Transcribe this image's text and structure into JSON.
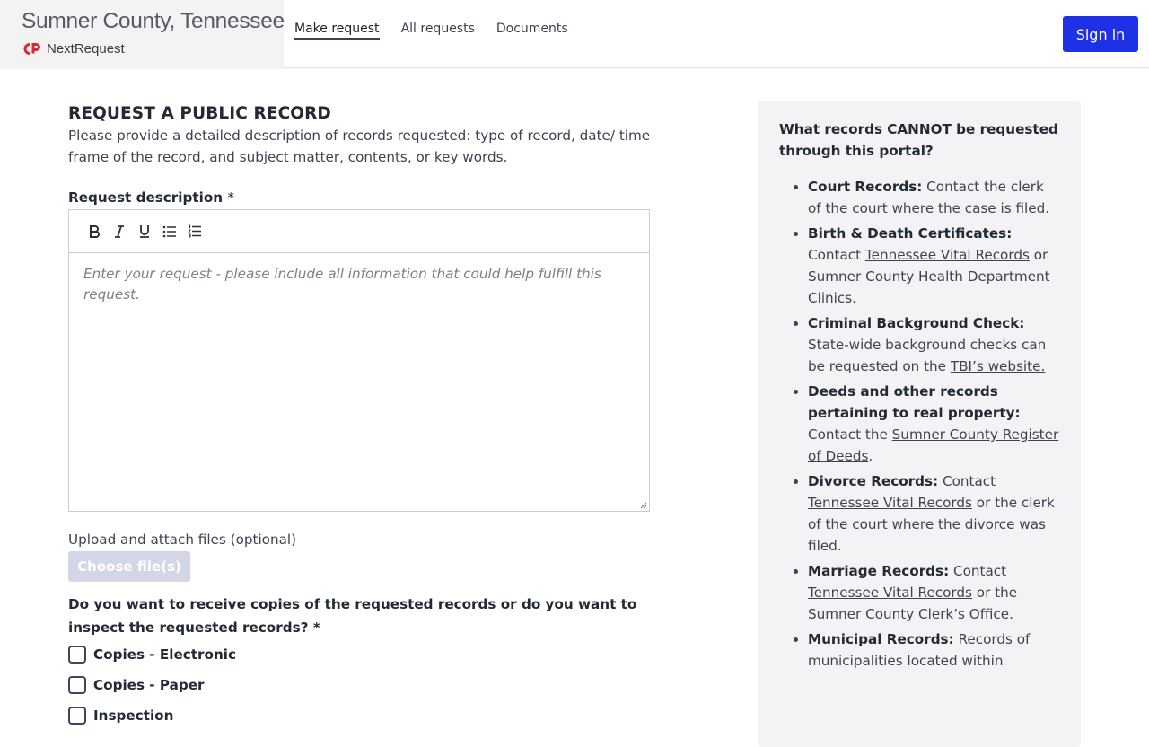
{
  "header": {
    "site_title": "Sumner County, Tennessee",
    "brand_name": "NextRequest",
    "nav": [
      {
        "label": "Make request",
        "active": true
      },
      {
        "label": "All requests",
        "active": false
      },
      {
        "label": "Documents",
        "active": false
      }
    ],
    "sign_in_label": "Sign in"
  },
  "form": {
    "title": "REQUEST A PUBLIC RECORD",
    "intro": "Please provide a detailed description of records requested: type of record, date/ time frame of the record, and subject matter, contents, or key words.",
    "description_label": "Request description",
    "required_mark": "*",
    "editor_toolbar": [
      "bold-icon",
      "italic-icon",
      "underline-icon",
      "bulleted-list-icon",
      "numbered-list-icon"
    ],
    "editor_placeholder": "Enter your request - please include all information that could help fulfill this request.",
    "upload_label": "Upload and attach files (optional)",
    "choose_files_label": "Choose file(s)",
    "delivery_question": "Do you want to receive copies of the requested records or do you want to inspect the requested records? *",
    "delivery_options": [
      {
        "label": "Copies - Electronic",
        "checked": false
      },
      {
        "label": "Copies - Paper",
        "checked": false
      },
      {
        "label": "Inspection",
        "checked": false
      }
    ]
  },
  "sidebar": {
    "title": "What records CANNOT be requested through this portal?",
    "items": [
      {
        "bold": "Court Records:",
        "parts": [
          {
            "text": " Contact the clerk of the court where the case is filed."
          }
        ]
      },
      {
        "bold": "Birth & Death Certificates:",
        "parts": [
          {
            "text": " Contact "
          },
          {
            "link": "Tennessee Vital Records"
          },
          {
            "text": " or Sumner County Health Department Clinics."
          }
        ]
      },
      {
        "bold": "Criminal Background Check:",
        "parts": [
          {
            "text": " State-wide background checks can be requested on the "
          },
          {
            "link": "TBI’s website."
          }
        ]
      },
      {
        "bold": "Deeds and other records pertaining to real property:",
        "parts": [
          {
            "text": " Contact the "
          },
          {
            "link": "Sumner County Register of Deeds"
          },
          {
            "text": "."
          }
        ]
      },
      {
        "bold": "Divorce Records:",
        "parts": [
          {
            "text": " Contact "
          },
          {
            "link": "Tennessee Vital Records"
          },
          {
            "text": " or the clerk of the court where the divorce was filed."
          }
        ]
      },
      {
        "bold": "Marriage Records:",
        "parts": [
          {
            "text": " Contact "
          },
          {
            "link": "Tennessee Vital Records"
          },
          {
            "text": " or the "
          },
          {
            "link": "Sumner County Clerk’s Office"
          },
          {
            "text": "."
          }
        ]
      },
      {
        "bold": "Municipal Records:",
        "parts": [
          {
            "text": " Records of municipalities located within"
          }
        ]
      }
    ]
  },
  "colors": {
    "primary_button": "#1f31e6",
    "brand_red": "#d62b36",
    "disabled_button": "#d3d6e6",
    "sidebar_bg": "#f3f3f5"
  }
}
